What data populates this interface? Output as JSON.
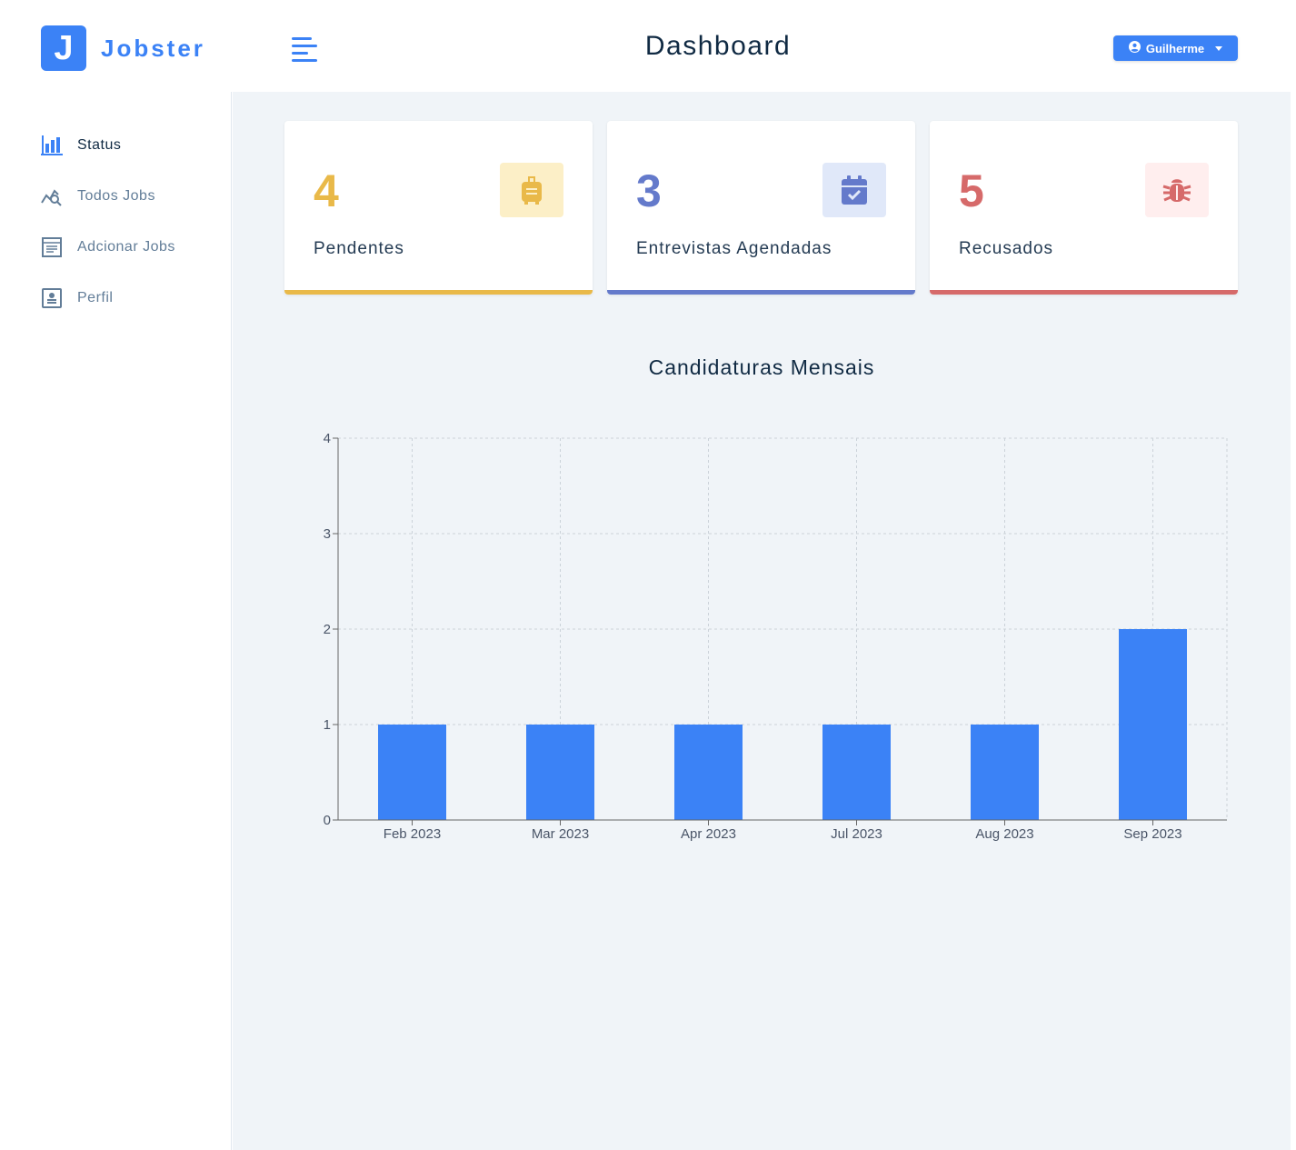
{
  "brand": {
    "logo_letter": "J",
    "name": "Jobster"
  },
  "header": {
    "title": "Dashboard",
    "user_name": "Guilherme"
  },
  "sidebar": {
    "items": [
      {
        "label": "Status",
        "icon": "bar-chart-icon",
        "active": true
      },
      {
        "label": "Todos Jobs",
        "icon": "search-chart-icon",
        "active": false
      },
      {
        "label": "Adcionar Jobs",
        "icon": "form-icon",
        "active": false
      },
      {
        "label": "Perfil",
        "icon": "profile-card-icon",
        "active": false
      }
    ]
  },
  "stats": [
    {
      "count": "4",
      "label": "Pendentes",
      "icon": "suitcase-icon",
      "color": "#e9b949",
      "bg": "#fcefc7"
    },
    {
      "count": "3",
      "label": "Entrevistas Agendadas",
      "icon": "calendar-check-icon",
      "color": "#647acb",
      "bg": "#e0e8f9"
    },
    {
      "count": "5",
      "label": "Recusados",
      "icon": "bug-icon",
      "color": "#d66a6a",
      "bg": "#ffeeee"
    }
  ],
  "chart_title": "Candidaturas Mensais",
  "chart_data": {
    "type": "bar",
    "title": "Candidaturas Mensais",
    "categories": [
      "Feb 2023",
      "Mar 2023",
      "Apr 2023",
      "Jul 2023",
      "Aug 2023",
      "Sep 2023"
    ],
    "values": [
      1,
      1,
      1,
      1,
      1,
      2
    ],
    "ylim": [
      0,
      4
    ],
    "yticks": [
      0,
      1,
      2,
      3,
      4
    ],
    "grid": true,
    "bar_color": "#3b82f6"
  }
}
